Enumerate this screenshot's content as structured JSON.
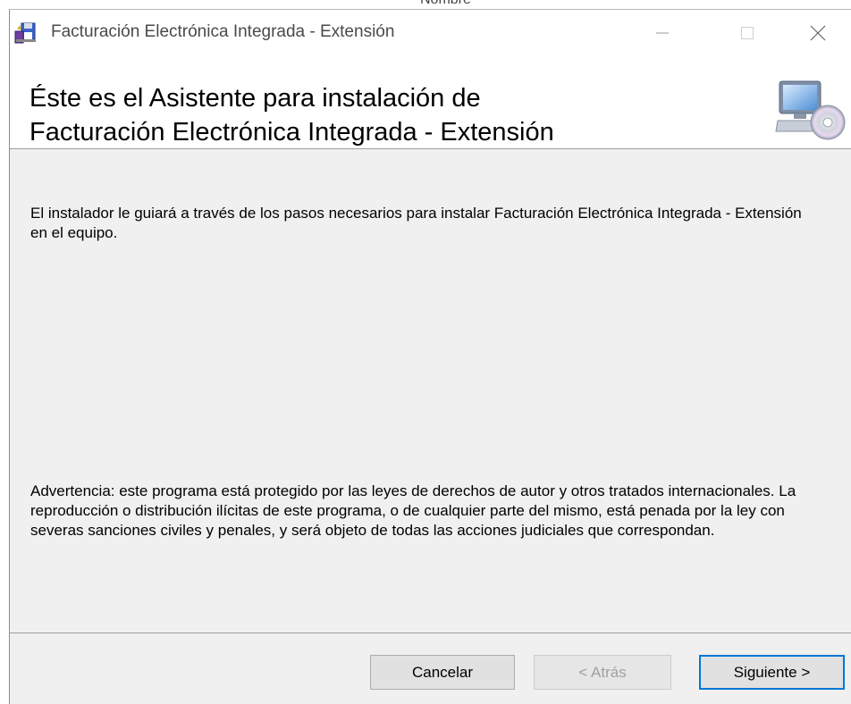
{
  "background_window": {
    "text": "Nombre"
  },
  "window": {
    "title": "Facturación Electrónica Integrada - Extensión",
    "controls": {
      "minimize": "—",
      "maximize": "☐",
      "close": "✕"
    }
  },
  "header": {
    "title": "Éste es el Asistente para instalación de\nFacturación Electrónica Integrada - Extensión",
    "icon": "computer-cd-icon"
  },
  "content": {
    "intro": "El instalador le guiará a través de los pasos necesarios para instalar Facturación Electrónica Integrada - Extensión en el equipo.",
    "warning": "Advertencia: este programa está protegido por las leyes de derechos de autor y otros tratados internacionales. La reproducción o distribución ilícitas de este programa, o de cualquier parte del mismo, está penada por la ley con severas sanciones civiles y penales, y será objeto de todas las acciones judiciales que correspondan."
  },
  "buttons": {
    "cancel": "Cancelar",
    "back": "< Atrás",
    "next": "Siguiente >"
  },
  "colors": {
    "content_bg": "#f0f0f0",
    "button_bg": "#e1e1e1",
    "focus_border": "#0078d7",
    "disabled_text": "#a0a0a0"
  }
}
